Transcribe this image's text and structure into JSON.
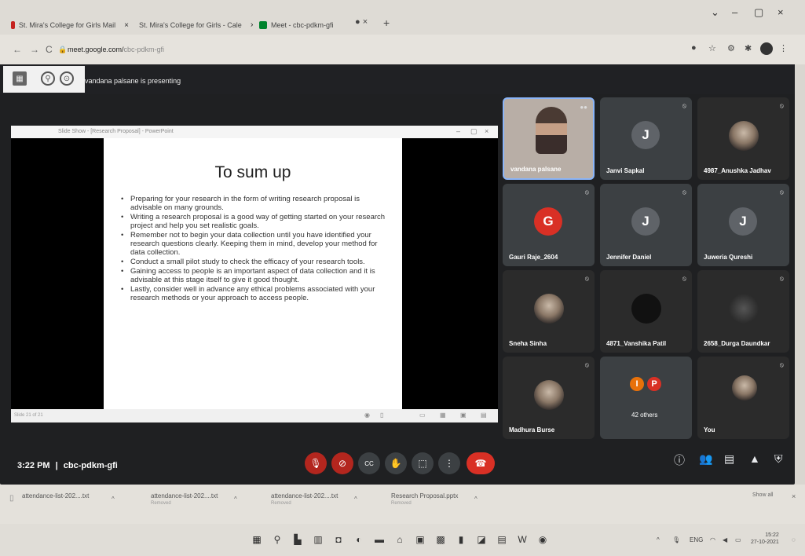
{
  "browser": {
    "tabs": [
      {
        "label": "St. Mira's College for Girls Mail",
        "fav_color": "#c5221f"
      },
      {
        "label": "St. Mira's College for Girls - Cale",
        "fav_color": "#1a73e8"
      },
      {
        "label": "Meet - cbc-pdkm-gfi",
        "fav_color": "#00832d"
      }
    ],
    "new_tab": "+",
    "url_host": "meet.google.com/",
    "url_path": "cbc-pdkm-gfi"
  },
  "meet": {
    "presenting_text": "vandana palsane is presenting",
    "time": "3:22 PM",
    "separator": "|",
    "meeting_code": "cbc-pdkm-gfi"
  },
  "slideshow": {
    "window_title": "Slide Show - [Research Proposal] - PowerPoint",
    "title": "To sum up",
    "bullets": [
      "Preparing for your research in the form of writing research proposal is advisable on many grounds.",
      "Writing a research proposal is a good way of getting started on your research project and help you set realistic goals.",
      "Remember not to begin your data collection until you have identified your research questions clearly. Keeping them in mind, develop your method for data collection.",
      "Conduct a small pilot study to check the efficacy of your research tools.",
      "Gaining access to people is an important aspect of data collection and it is advisable at this stage itself to give it good thought.",
      "Lastly, consider well in advance any ethical problems associated with your research methods or your approach to access people."
    ],
    "slide_counter": "Slide 21 of 21"
  },
  "participants": [
    {
      "name": "vandana palsane",
      "type": "presenter"
    },
    {
      "name": "Janvi Sapkal",
      "initial": "J",
      "color": "#5f6368"
    },
    {
      "name": "4987_Anushka Jadhav",
      "type": "photo"
    },
    {
      "name": "Gauri Raje_2604",
      "initial": "G",
      "color": "#d93025"
    },
    {
      "name": "Jennifer Daniel",
      "initial": "J",
      "color": "#5f6368"
    },
    {
      "name": "Juweria Qureshi",
      "initial": "J",
      "color": "#5f6368"
    },
    {
      "name": "Sneha Sinha",
      "type": "photo"
    },
    {
      "name": "4871_Vanshika Patil",
      "type": "photo"
    },
    {
      "name": "2658_Durga Daundkar",
      "type": "photo"
    },
    {
      "name": "Madhura Burse",
      "type": "photo"
    },
    {
      "name": "42 others",
      "type": "others",
      "initials": [
        "I",
        "P"
      ]
    },
    {
      "name": "You",
      "type": "photo"
    }
  ],
  "downloads": [
    {
      "name": "attendance-list-202....txt",
      "status": ""
    },
    {
      "name": "attendance-list-202....txt",
      "status": "Removed"
    },
    {
      "name": "attendance-list-202....txt",
      "status": "Removed"
    },
    {
      "name": "Research Proposal.pptx",
      "status": "Removed"
    }
  ],
  "downloads_show_all": "Show all",
  "taskbar": {
    "time": "15:22",
    "date": "27-10-2021"
  },
  "icons": {
    "mic_off": "🎙",
    "cam_off": "⊘",
    "captions": "CC",
    "raise_hand": "✋",
    "present": "⬚",
    "more": "⋮",
    "end_call": "☎",
    "info": "ⓘ",
    "people": "👥",
    "chat": "▤",
    "activities": "▲",
    "host": "⛨"
  }
}
